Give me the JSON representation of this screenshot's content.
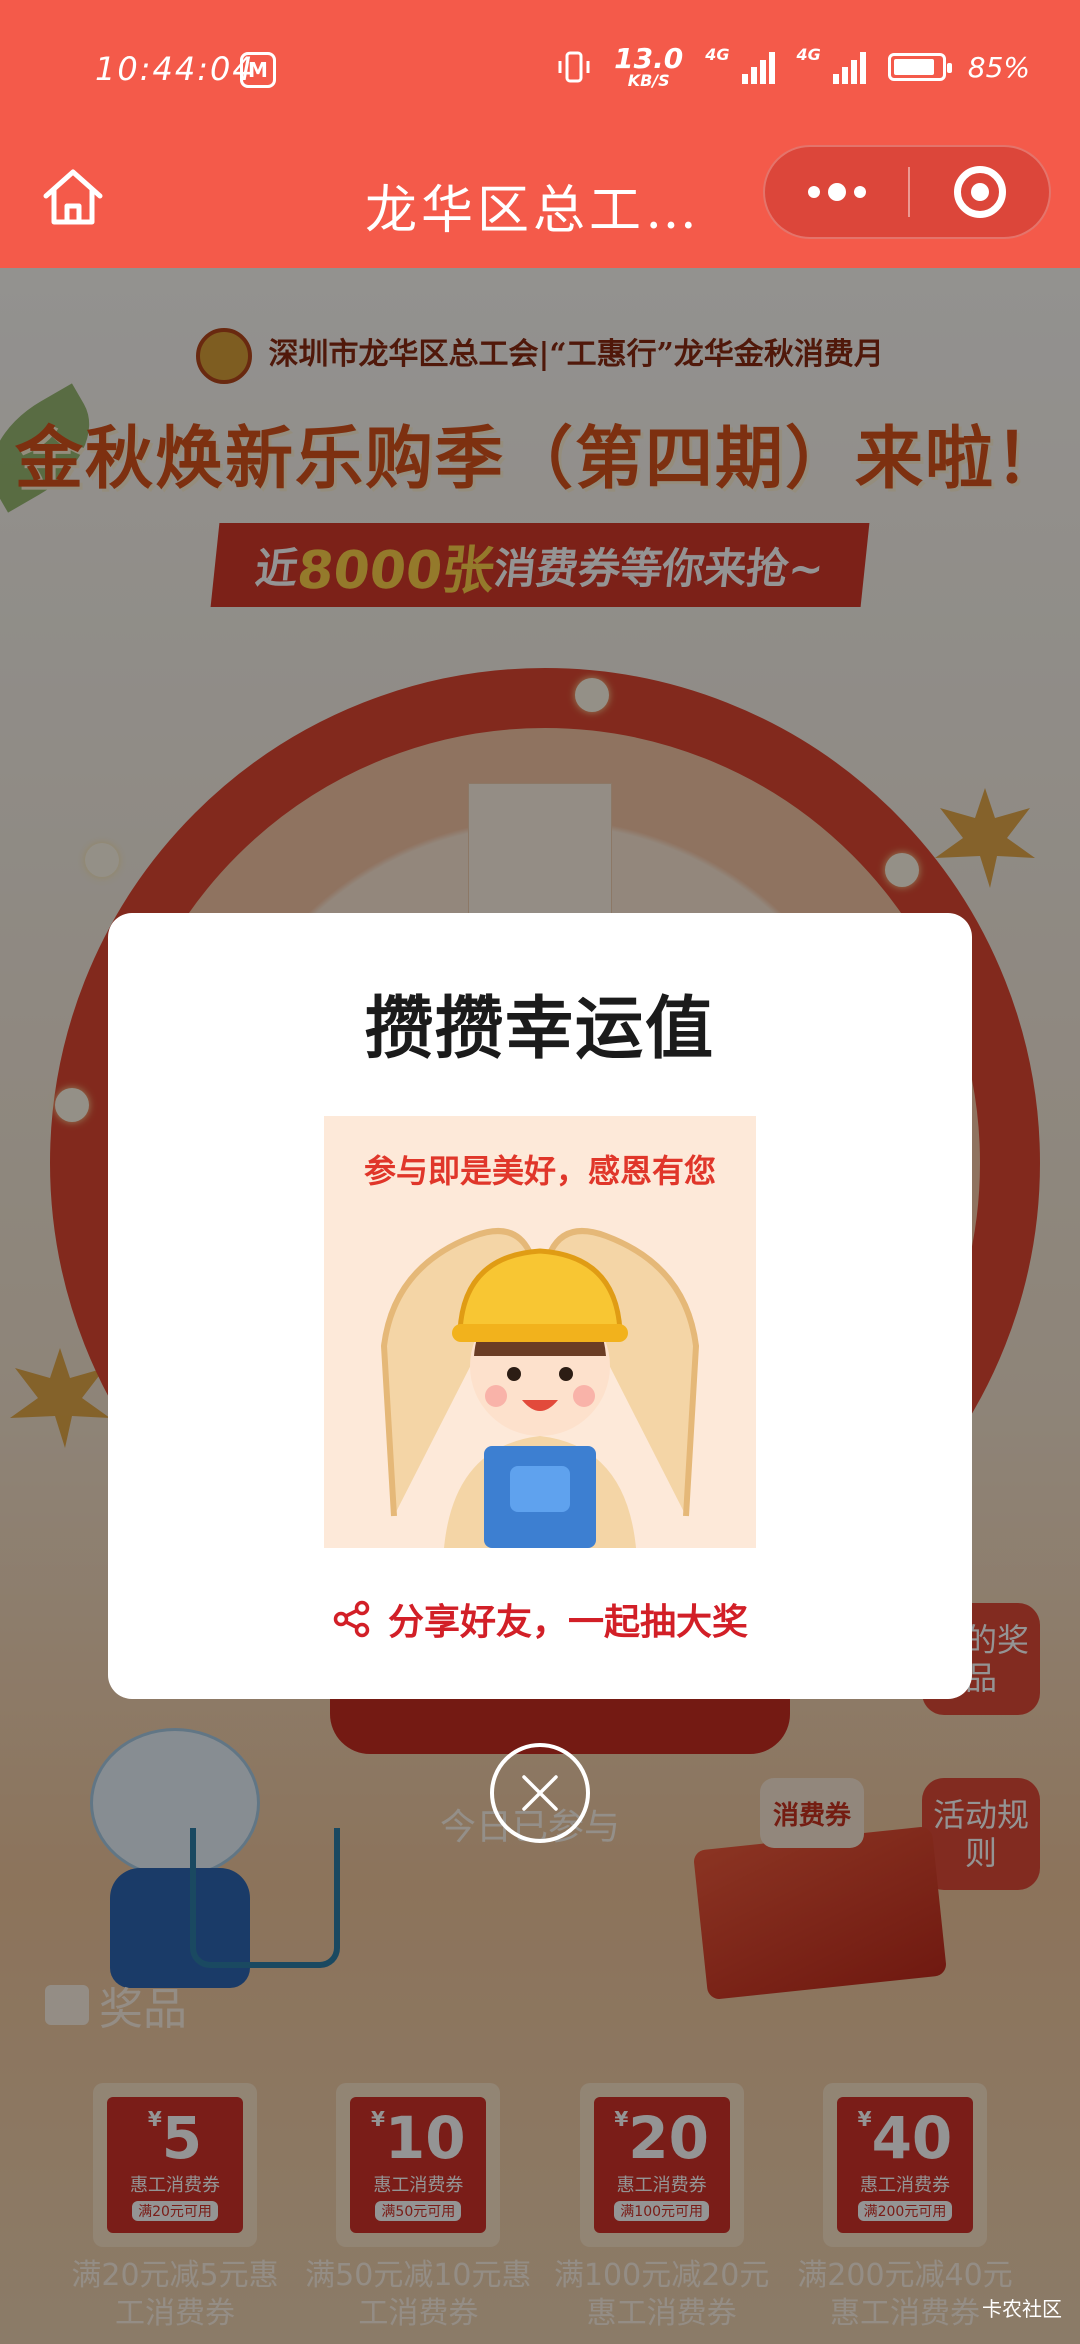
{
  "status_bar": {
    "time": "10:44:04",
    "app_icon_text": "M",
    "net_speed_value": "13.0",
    "net_speed_unit": "KB/S",
    "network_label_1": "4G",
    "network_label_2": "4G",
    "battery": "85%"
  },
  "navbar": {
    "title": "龙华区总工…"
  },
  "banner": {
    "org_line": "深圳市龙华区总工会|“工惠行”龙华金秋消费月",
    "title": "金秋焕新乐购季（第四期）来啦！",
    "subtitle_prefix": "近",
    "subtitle_highlight": "8000张",
    "subtitle_suffix": "消费券等你来抢~",
    "mini_prize_caption": "参与即是美好，感恩有您"
  },
  "page": {
    "today_text": "今日已参与",
    "my_prizes_label": "我的奖品",
    "rules_label": "活动规则",
    "coupon_chip_label": "消费券",
    "prizes_section_title": "奖品",
    "prizes": [
      {
        "amount": "5",
        "currency": "¥",
        "type": "惠工消费券",
        "condition": "满20元可用",
        "label": "满20元减5元惠工消费券"
      },
      {
        "amount": "10",
        "currency": "¥",
        "type": "惠工消费券",
        "condition": "满50元可用",
        "label": "满50元减10元惠工消费券"
      },
      {
        "amount": "20",
        "currency": "¥",
        "type": "惠工消费券",
        "condition": "满100元可用",
        "label": "满100元减20元惠工消费券"
      },
      {
        "amount": "40",
        "currency": "¥",
        "type": "惠工消费券",
        "condition": "满200元可用",
        "label": "满200元减40元惠工消费券"
      }
    ]
  },
  "modal": {
    "title": "攒攒幸运值",
    "image_caption": "参与即是美好，感恩有您",
    "share_label": "分享好友，一起抽大奖"
  },
  "watermark": "卡农社区",
  "colors": {
    "header_red": "#f45a4a",
    "accent_red": "#d21f27",
    "coupon_red": "#d2332a"
  }
}
